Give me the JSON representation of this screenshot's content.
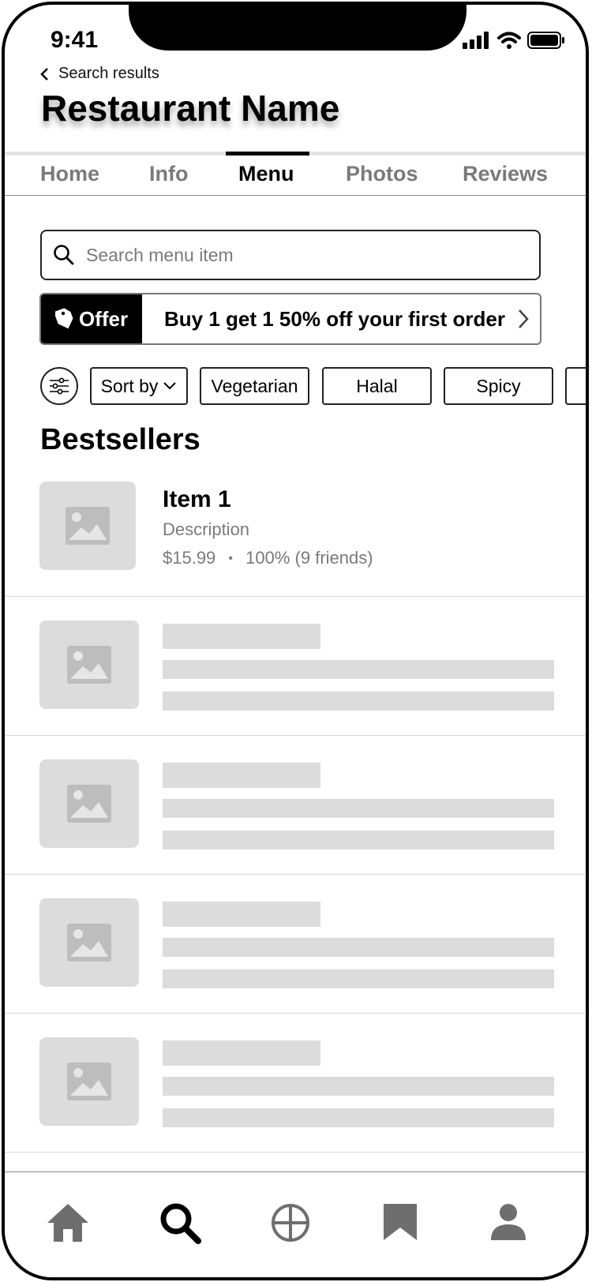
{
  "status_bar": {
    "time": "9:41"
  },
  "header": {
    "back_label": "Search results",
    "title": "Restaurant Name"
  },
  "tabs": [
    {
      "label": "Home",
      "active": false
    },
    {
      "label": "Info",
      "active": false
    },
    {
      "label": "Menu",
      "active": true
    },
    {
      "label": "Photos",
      "active": false
    },
    {
      "label": "Reviews",
      "active": false
    }
  ],
  "search": {
    "placeholder": "Search menu item"
  },
  "offer": {
    "badge": "Offer",
    "text": "Buy 1 get 1 50% off your first order"
  },
  "filters": {
    "sort_label": "Sort by",
    "chips": [
      "Vegetarian",
      "Halal",
      "Spicy"
    ]
  },
  "section": {
    "title": "Bestsellers"
  },
  "items": [
    {
      "name": "Item 1",
      "description": "Description",
      "price": "$15.99",
      "separator": "•",
      "rating": "100% (9 friends)"
    }
  ],
  "bottom_nav": {
    "icons": [
      "home-icon",
      "search-icon",
      "explore-icon",
      "bookmark-icon",
      "profile-icon"
    ],
    "active": "search-icon"
  },
  "colors": {
    "primary": "#000000",
    "muted": "#7a7a7a",
    "placeholder_fill": "#dcdcdc",
    "icon_inactive": "#6e6e6e"
  }
}
